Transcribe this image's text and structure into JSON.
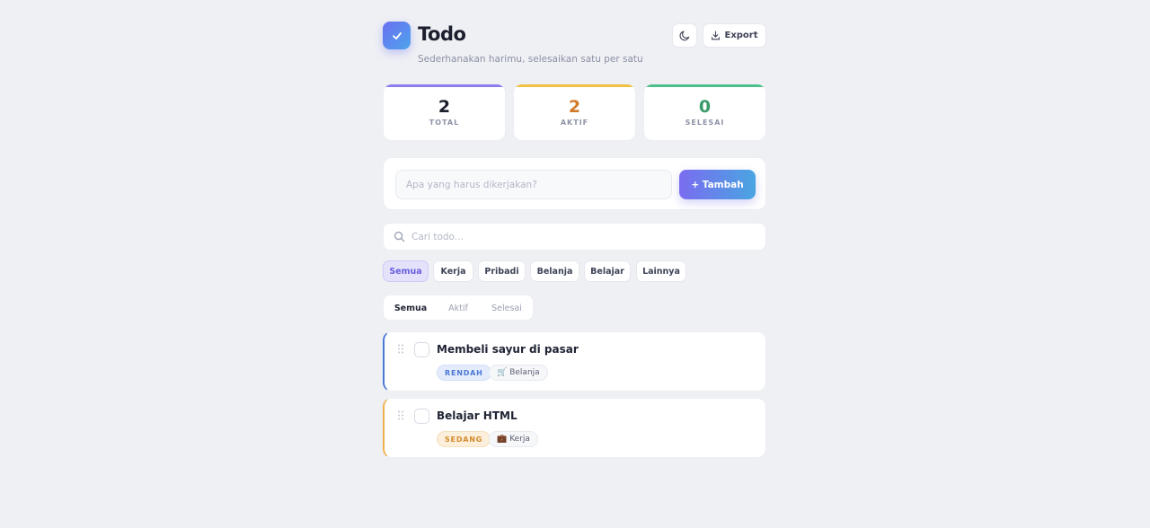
{
  "header": {
    "title": "Todo",
    "subtitle": "Sederhanakan harimu, selesaikan satu per satu",
    "export_label": "Export",
    "logo_icon": "check-icon",
    "theme_icon": "moon-icon",
    "export_icon": "download-icon"
  },
  "stats": [
    {
      "value": "2",
      "label": "TOTAL",
      "color": "#1b1e2c",
      "bar": "#8b7cf0"
    },
    {
      "value": "2",
      "label": "AKTIF",
      "color": "#d27a2a",
      "bar": "#f0c040"
    },
    {
      "value": "0",
      "label": "SELESAI",
      "color": "#3a9a6a",
      "bar": "#4cc08a"
    }
  ],
  "add": {
    "placeholder": "Apa yang harus dikerjakan?",
    "button_label": "+ Tambah"
  },
  "search": {
    "placeholder": "Cari todo..."
  },
  "categories": [
    "Semua",
    "Kerja",
    "Pribadi",
    "Belanja",
    "Belajar",
    "Lainnya"
  ],
  "active_category": "Semua",
  "status_tabs": [
    "Semua",
    "Aktif",
    "Selesai"
  ],
  "active_status": "Semua",
  "todos": [
    {
      "title": "Membeli sayur di pasar",
      "priority": "RENDAH",
      "category_icon": "🛒",
      "category": "Belanja",
      "accent": "#4a78d6",
      "done": false
    },
    {
      "title": "Belajar HTML",
      "priority": "SEDANG",
      "category_icon": "💼",
      "category": "Kerja",
      "accent": "#f0b050",
      "done": false
    }
  ]
}
